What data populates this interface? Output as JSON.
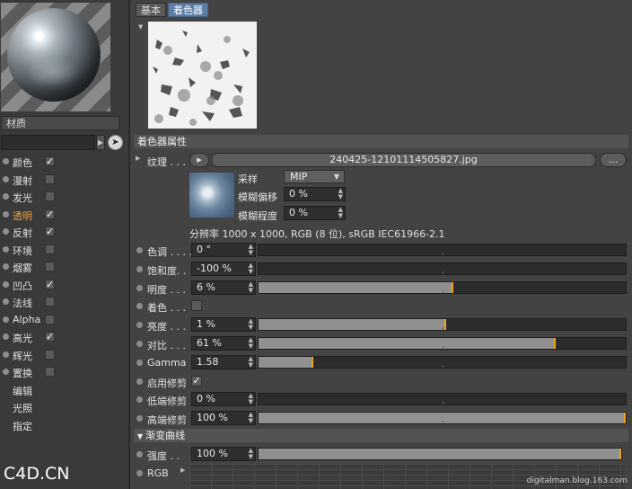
{
  "left_panel": {
    "material_label": "材质",
    "channels": [
      {
        "name": "颜色",
        "checked": true,
        "active": false
      },
      {
        "name": "漫射",
        "checked": false,
        "active": false
      },
      {
        "name": "发光",
        "checked": false,
        "active": false
      },
      {
        "name": "透明",
        "checked": true,
        "active": true
      },
      {
        "name": "反射",
        "checked": true,
        "active": false
      },
      {
        "name": "环境",
        "checked": false,
        "active": false
      },
      {
        "name": "烟雾",
        "checked": false,
        "active": false
      },
      {
        "name": "凹凸",
        "checked": true,
        "active": false
      },
      {
        "name": "法线",
        "checked": false,
        "active": false
      },
      {
        "name": "Alpha",
        "checked": false,
        "active": false
      },
      {
        "name": "高光",
        "checked": true,
        "active": false
      },
      {
        "name": "辉光",
        "checked": false,
        "active": false
      },
      {
        "name": "置换",
        "checked": false,
        "active": false
      }
    ],
    "extras": [
      "编辑",
      "光照",
      "指定"
    ],
    "check_glyph": "✓"
  },
  "tabs": {
    "basic": "基本",
    "shader": "着色器"
  },
  "shader_props": {
    "title": "着色器属性",
    "texture_label": "纹理 . . .",
    "texture_file": "240425-12101114505827.jpg",
    "more_button": "...",
    "sampling_label": "采样",
    "sampling_value": "MIP",
    "blur_offset_label": "模糊偏移",
    "blur_offset_value": "0 %",
    "blur_degree_label": "模糊程度",
    "blur_degree_value": "0 %",
    "resolution_info": "分辨率 1000 x 1000, RGB (8 位), sRGB IEC61966-2.1"
  },
  "rows": [
    {
      "label": "色调 . . . .",
      "value": "0 °",
      "fill": 0,
      "mark": 0,
      "kind": "slider"
    },
    {
      "label": "饱和度. .",
      "value": "-100 %",
      "fill": 0,
      "mark": 0,
      "kind": "slider"
    },
    {
      "label": "明度 . . .",
      "value": "6 %",
      "fill": 0.53,
      "mark": 0.53,
      "kind": "slider"
    },
    {
      "label": "着色 . . .",
      "value": "",
      "kind": "checkbox",
      "checked": false
    },
    {
      "label": "亮度 . . .",
      "value": "1 %",
      "fill": 0.51,
      "mark": 0.51,
      "kind": "slider"
    },
    {
      "label": "对比 . . .",
      "value": "61 %",
      "fill": 0.81,
      "mark": 0.81,
      "kind": "slider"
    },
    {
      "label": "Gamma",
      "value": "1.58",
      "fill": 0.15,
      "mark": 0.15,
      "kind": "slider"
    },
    {
      "label": "启用修剪",
      "value": "",
      "kind": "checkbox",
      "checked": true
    },
    {
      "label": "低端修剪",
      "value": "0 %",
      "fill": 0,
      "mark": 0,
      "kind": "slider"
    },
    {
      "label": "高端修剪",
      "value": "100 %",
      "fill": 1,
      "mark": 1,
      "kind": "slider"
    }
  ],
  "curve_section": {
    "title": "渐变曲线",
    "strength_label": "强度 . .",
    "strength_value": "100 %",
    "strength_fill": 1,
    "rgb_label": "RGB"
  },
  "watermarks": {
    "left": "C4D.CN",
    "right": "digitalman.blog.163.com"
  },
  "colors": {
    "accent": "#f0a020",
    "active_channel": "#f2a33a",
    "tab_active": "#5d7ea7"
  }
}
